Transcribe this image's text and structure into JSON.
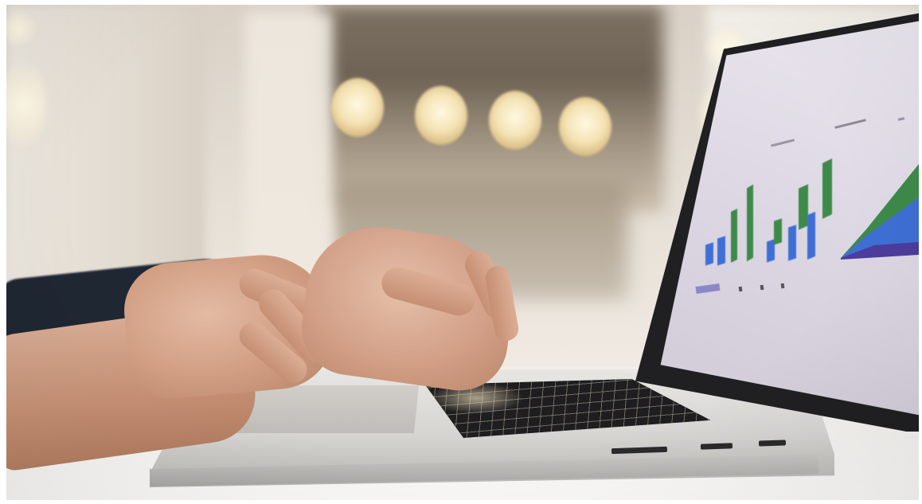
{
  "scene": {
    "description_colors": {
      "background": "#e7e1d8",
      "sleeve": "#1f2733",
      "skin": "#d19d82",
      "laptop_body": "#d7d5d2",
      "screen": "#dcd7e3",
      "bar_blue": "#3f6fd4",
      "bar_green": "#3e8a4a",
      "area_purple": "#4d3c9c"
    }
  }
}
